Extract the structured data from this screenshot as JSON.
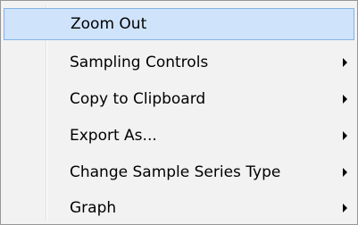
{
  "context_menu": {
    "items": [
      {
        "label": "Zoom Out",
        "has_submenu": false,
        "highlighted": true
      },
      {
        "label": "Sampling Controls",
        "has_submenu": true,
        "highlighted": false
      },
      {
        "label": "Copy to Clipboard",
        "has_submenu": true,
        "highlighted": false
      },
      {
        "label": "Export As...",
        "has_submenu": true,
        "highlighted": false
      },
      {
        "label": "Change Sample Series Type",
        "has_submenu": true,
        "highlighted": false
      },
      {
        "label": "Graph",
        "has_submenu": true,
        "highlighted": false
      }
    ],
    "colors": {
      "background": "#f2f2f2",
      "highlight_fill": "#cfe3fb",
      "highlight_border": "#84b4ea"
    }
  }
}
